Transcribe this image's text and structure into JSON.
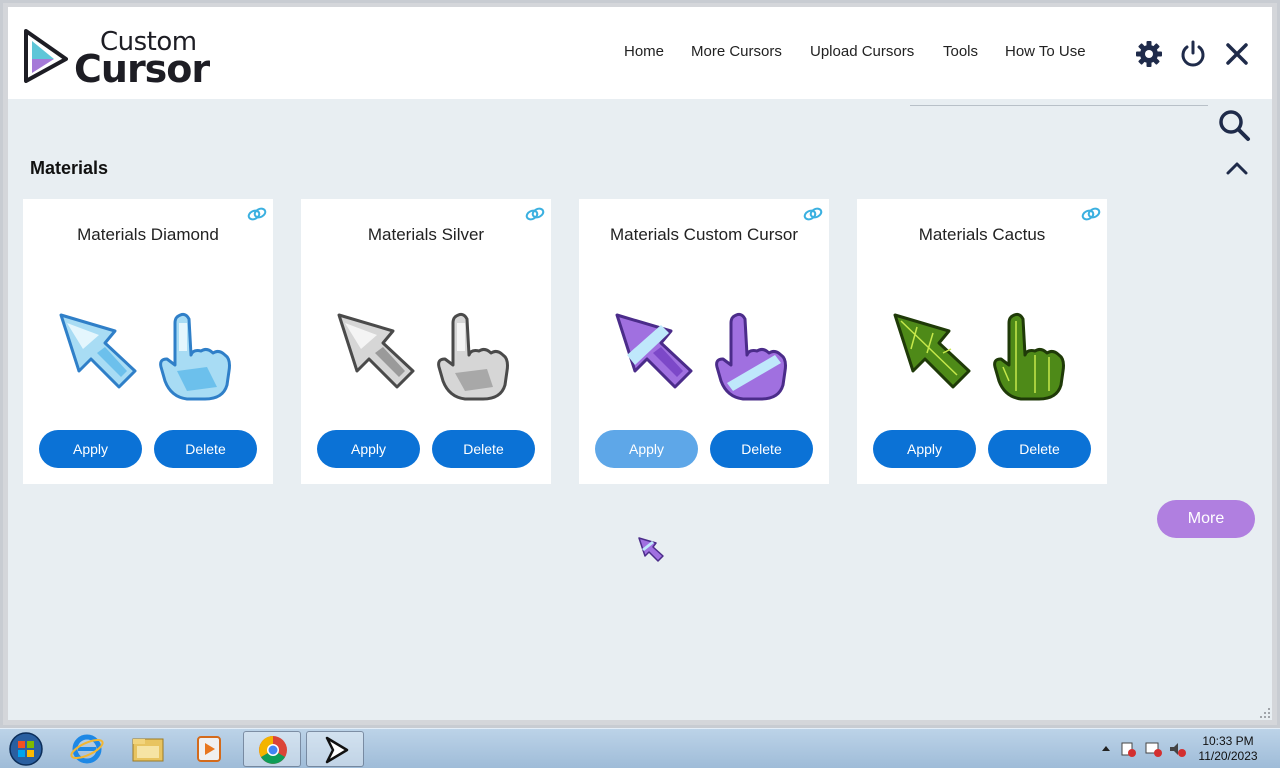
{
  "app": {
    "logo_line1": "Custom",
    "logo_line2": "Cursor"
  },
  "nav": {
    "items": [
      {
        "label": "Home"
      },
      {
        "label": "More Cursors"
      },
      {
        "label": "Upload Cursors"
      },
      {
        "label": "Tools"
      },
      {
        "label": "How To Use"
      }
    ],
    "icons": [
      "gear-icon",
      "power-icon",
      "close-icon"
    ]
  },
  "search": {
    "value": "",
    "icon": "search-icon"
  },
  "section": {
    "title": "Materials",
    "collapse_icon": "chevron-up-icon"
  },
  "cards": [
    {
      "title": "Materials Diamond",
      "apply_label": "Apply",
      "delete_label": "Delete",
      "style": "diamond"
    },
    {
      "title": "Materials Silver",
      "apply_label": "Apply",
      "delete_label": "Delete",
      "style": "silver"
    },
    {
      "title": "Materials Custom Cursor",
      "apply_label": "Apply",
      "delete_label": "Delete",
      "style": "purple",
      "applied": true
    },
    {
      "title": "Materials Cactus",
      "apply_label": "Apply",
      "delete_label": "Delete",
      "style": "cactus"
    }
  ],
  "more_label": "More",
  "colors": {
    "primary": "#0b72d6",
    "primary_active": "#5ea7e8",
    "more": "#b07fe0",
    "link": "#3bb0e0",
    "background": "#e8eef2"
  },
  "taskbar": {
    "apps": [
      "internet-explorer-icon",
      "file-explorer-icon",
      "media-player-icon",
      "chrome-icon",
      "custom-cursor-icon"
    ],
    "time": "10:33 PM",
    "date": "11/20/2023"
  }
}
